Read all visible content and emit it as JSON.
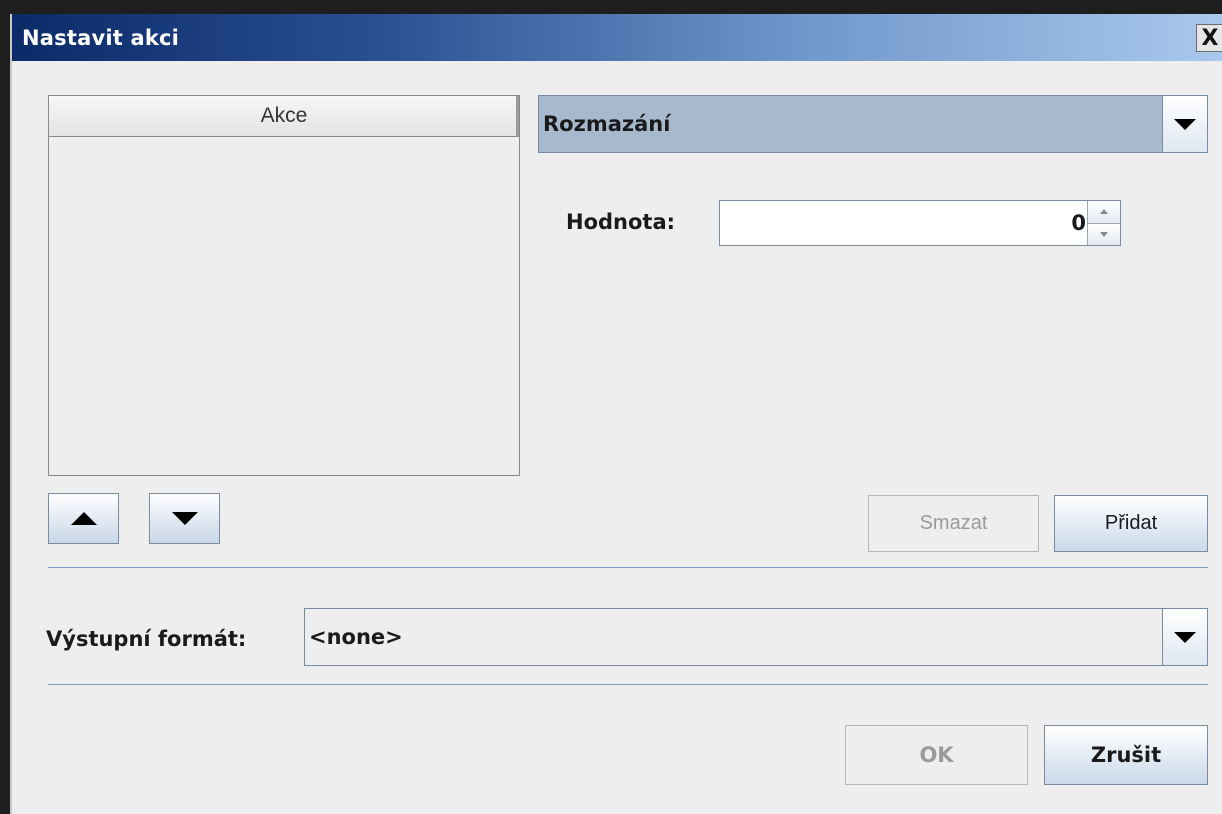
{
  "window": {
    "title": "Nastavit akci",
    "close_label": "X"
  },
  "actions_list": {
    "header": "Akce",
    "items": []
  },
  "move_buttons": {
    "up_icon": "triangle-up-icon",
    "down_icon": "triangle-down-icon"
  },
  "action_select": {
    "selected": "Rozmazání"
  },
  "value_field": {
    "label": "Hodnota:",
    "value": "0"
  },
  "buttons": {
    "delete_label": "Smazat",
    "add_label": "Přidat",
    "ok_label": "OK",
    "cancel_label": "Zrušit"
  },
  "output_format": {
    "label": "Výstupní formát:",
    "selected": "<none>"
  },
  "colors": {
    "titlebar_start": "#0b2a68",
    "titlebar_end": "#a9c8ec",
    "combo_selected_bg": "#a7b9cf",
    "separator": "#7e9ac4"
  }
}
